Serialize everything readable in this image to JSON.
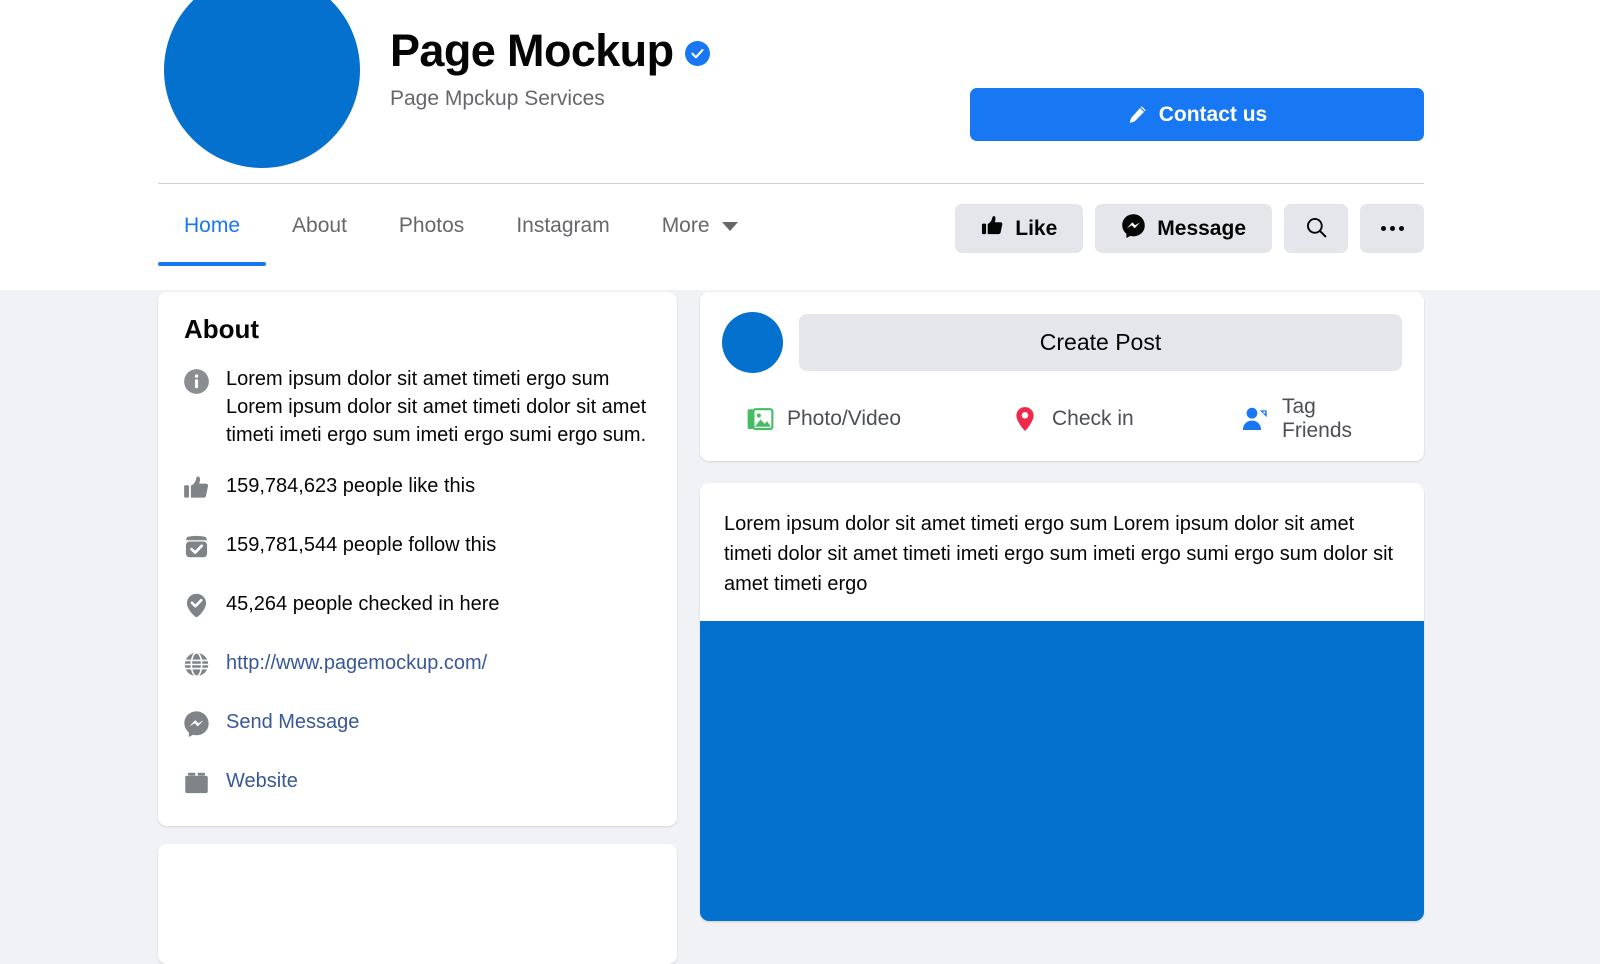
{
  "header": {
    "avatar_icon": "page-avatar-circle",
    "page_title": "Page Mockup",
    "verified_icon": "verified-check-icon",
    "page_subtitle": "Page Mpckup Services",
    "contact_button": {
      "label": "Contact us",
      "icon": "pencil-icon"
    }
  },
  "nav": {
    "tabs": [
      {
        "label": "Home",
        "active": true
      },
      {
        "label": "About",
        "active": false
      },
      {
        "label": "Photos",
        "active": false
      },
      {
        "label": "Instagram",
        "active": false
      },
      {
        "label": "More",
        "active": false,
        "icon": "chevron-down-icon"
      }
    ],
    "actions": {
      "like_label": "Like",
      "like_icon": "thumbs-up-icon",
      "message_label": "Message",
      "message_icon": "messenger-icon",
      "search_icon": "search-icon",
      "more_icon": "ellipsis-icon"
    }
  },
  "about": {
    "title": "About",
    "description": {
      "icon": "info-icon",
      "text": "Lorem ipsum dolor sit amet timeti ergo sum Lorem ipsum dolor sit amet timeti dolor sit amet timeti imeti ergo sum imeti ergo sumi ergo sum."
    },
    "stats": [
      {
        "icon": "thumbs-up-icon",
        "text": "159,784,623 people like this"
      },
      {
        "icon": "follow-box-check-icon",
        "text": "159,781,544 people follow this"
      },
      {
        "icon": "location-check-icon",
        "text": "45,264 people checked in here"
      }
    ],
    "links": [
      {
        "icon": "globe-icon",
        "text": "http://www.pagemockup.com/"
      },
      {
        "icon": "messenger-icon",
        "text": "Send Message"
      },
      {
        "icon": "briefcase-icon",
        "text": "Website"
      }
    ]
  },
  "create_post": {
    "avatar_icon": "composer-avatar-circle",
    "input_placeholder": "Create Post",
    "actions": [
      {
        "label": "Photo/Video",
        "icon": "photo-video-icon"
      },
      {
        "label": "Check in",
        "icon": "location-pin-icon"
      },
      {
        "label": "Tag Friends",
        "icon": "tag-friends-icon"
      }
    ]
  },
  "post": {
    "text": "Lorem ipsum dolor sit amet timeti ergo sum Lorem ipsum dolor sit amet timeti dolor sit amet timeti imeti ergo sum imeti ergo sumi ergo sum  dolor sit amet timeti ergo",
    "image_alt": "post-image"
  },
  "colors": {
    "brand_blue": "#1877f2",
    "avatar_blue": "#0571ce",
    "link_blue": "#385898",
    "page_bg": "#f0f2f5",
    "card_bg": "#ffffff",
    "pill_bg": "#e4e6eb",
    "muted_text": "#65676b",
    "icon_gray": "#7f8489",
    "green": "#45bd62",
    "red": "#f02849"
  }
}
